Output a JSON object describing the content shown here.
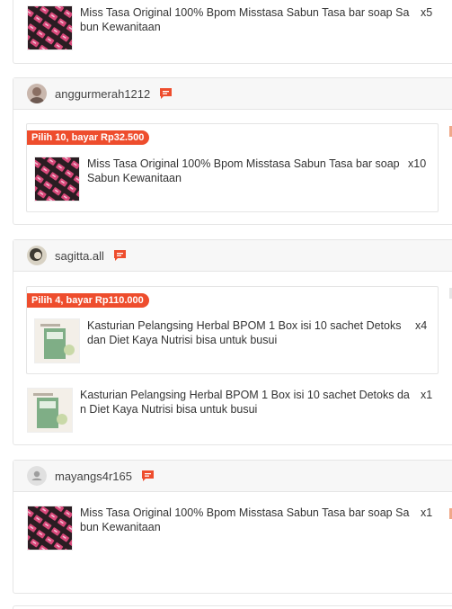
{
  "orders": [
    {
      "items": [
        {
          "name": "Miss Tasa Original 100% Bpom Misstasa Sabun Tasa bar soap Sabun Kewanitaan",
          "qty": "x5",
          "thumb": "soap-pattern-thumb"
        }
      ]
    },
    {
      "username": "anggurmerah1212",
      "bundle_label": "Pilih 10, bayar Rp32.500",
      "items": [
        {
          "name": "Miss Tasa Original 100% Bpom Misstasa Sabun Tasa bar soap Sabun Kewanitaan",
          "qty": "x10",
          "thumb": "soap-pattern-thumb"
        }
      ]
    },
    {
      "username": "sagitta.all",
      "bundle_label": "Pilih 4, bayar Rp110.000",
      "items": [
        {
          "name": "Kasturian Pelangsing Herbal BPOM 1 Box isi 10 sachet Detoks dan Diet Kaya Nutrisi bisa untuk busui",
          "qty": "x4",
          "thumb": "herbal-box-thumb"
        },
        {
          "name": "Kasturian Pelangsing Herbal BPOM 1 Box isi 10 sachet Detoks dan Diet Kaya Nutrisi bisa untuk busui",
          "qty": "x1",
          "thumb": "herbal-box-thumb"
        }
      ]
    },
    {
      "username": "mayangs4r165",
      "items": [
        {
          "name": "Miss Tasa Original 100% Bpom Misstasa Sabun Tasa bar soap Sabun Kewanitaan",
          "qty": "x1",
          "thumb": "soap-pattern-thumb"
        }
      ]
    }
  ],
  "colors": {
    "accent": "#ee4d2d",
    "border": "#e5e5e5",
    "header_bg": "#f7f7f7"
  },
  "icons": {
    "chat": "chat-icon",
    "default_avatar": "default-avatar-icon"
  }
}
